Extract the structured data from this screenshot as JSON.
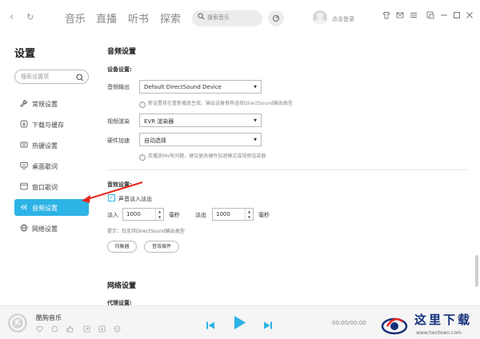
{
  "topbar": {
    "back_glyph": "‹",
    "refresh_glyph": "↻",
    "tabs": [
      "音乐",
      "直播",
      "听书",
      "探索"
    ],
    "search_placeholder": "搜索音乐",
    "search_icon": "search-icon",
    "mic_icon": "mic-icon",
    "login_text": "点击登录",
    "window_icons": [
      "shirt-icon",
      "mail-icon",
      "menu-icon",
      "mini-mode-icon",
      "minimize-icon",
      "maximize-icon",
      "close-icon"
    ]
  },
  "sidebar": {
    "title": "设置",
    "search_placeholder": "搜索设置项",
    "items": [
      {
        "label": "常规设置",
        "icon": "wrench-icon"
      },
      {
        "label": "下载与缓存",
        "icon": "download-icon"
      },
      {
        "label": "热键设置",
        "icon": "keyboard-icon"
      },
      {
        "label": "桌面歌词",
        "icon": "desktop-lyrics-icon"
      },
      {
        "label": "窗口歌词",
        "icon": "window-lyrics-icon"
      },
      {
        "label": "音频设置",
        "icon": "audio-wave-icon",
        "active": true
      },
      {
        "label": "网络设置",
        "icon": "globe-icon"
      }
    ],
    "active_color": "#2db3e6"
  },
  "main": {
    "audio_title": "音频设置",
    "device_title": "设备设置:",
    "output_label": "音频输出",
    "output_value": "Default DirectSound Device",
    "output_hint": "新设置将在重新播放生效。输出设备推荐选择DirectSound输出类型",
    "video_label": "视频渲染",
    "video_value": "EVR 渲染器",
    "hw_label": "硬件加速",
    "hw_value": "自动选择",
    "hw_hint": "若播放MV有问题，建议更改硬件加速模式或视频渲染器",
    "effect_title": "音效设置:",
    "fade_label": "声音淡入淡出",
    "fade_checked": true,
    "fade_in_label": "淡入",
    "fade_in_value": "1000",
    "fade_in_unit": "毫秒",
    "fade_out_label": "淡出",
    "fade_out_value": "1000",
    "fade_out_unit": "毫秒",
    "tip": "提示：仅支持DirectSound输出类型",
    "eq_button": "均衡器",
    "plugin_button": "音效插件",
    "network_title": "网络设置",
    "proxy_title": "代理设置:"
  },
  "player": {
    "song": "酷狗音乐",
    "logo_letter": "K",
    "time": "00:00/00:00",
    "left_icons": [
      "heart-icon",
      "comment-icon",
      "like-icon",
      "share-icon",
      "download-icon",
      "more-icon"
    ]
  },
  "watermark": {
    "title": "这里下载",
    "url": "www.herdown.com"
  }
}
